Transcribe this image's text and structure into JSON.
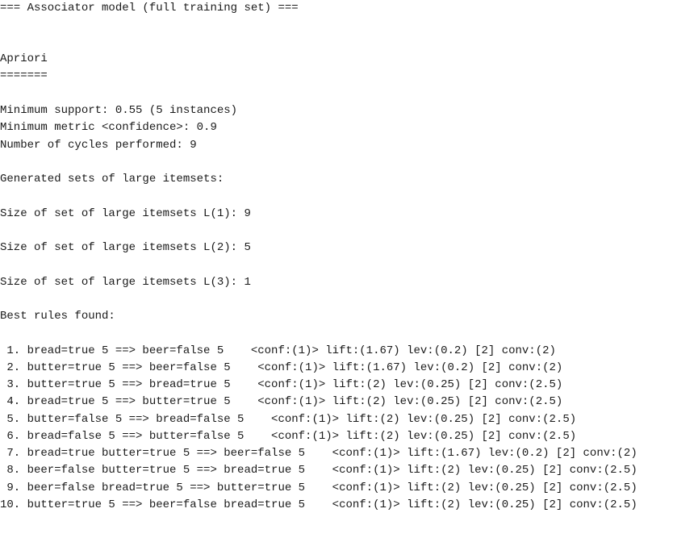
{
  "output": {
    "header": "=== Associator model (full training set) ===",
    "algorithm": "Apriori",
    "underline": "=======",
    "min_support": "Minimum support: 0.55 (5 instances)",
    "min_metric": "Minimum metric <confidence>: 0.9",
    "cycles": "Number of cycles performed: 9",
    "generated": "Generated sets of large itemsets:",
    "l1": "Size of set of large itemsets L(1): 9",
    "l2": "Size of set of large itemsets L(2): 5",
    "l3": "Size of set of large itemsets L(3): 1",
    "best_rules": "Best rules found:",
    "rules": [
      " 1. bread=true 5 ==> beer=false 5    <conf:(1)> lift:(1.67) lev:(0.2) [2] conv:(2)",
      " 2. butter=true 5 ==> beer=false 5    <conf:(1)> lift:(1.67) lev:(0.2) [2] conv:(2)",
      " 3. butter=true 5 ==> bread=true 5    <conf:(1)> lift:(2) lev:(0.25) [2] conv:(2.5)",
      " 4. bread=true 5 ==> butter=true 5    <conf:(1)> lift:(2) lev:(0.25) [2] conv:(2.5)",
      " 5. butter=false 5 ==> bread=false 5    <conf:(1)> lift:(2) lev:(0.25) [2] conv:(2.5)",
      " 6. bread=false 5 ==> butter=false 5    <conf:(1)> lift:(2) lev:(0.25) [2] conv:(2.5)",
      " 7. bread=true butter=true 5 ==> beer=false 5    <conf:(1)> lift:(1.67) lev:(0.2) [2] conv:(2)",
      " 8. beer=false butter=true 5 ==> bread=true 5    <conf:(1)> lift:(2) lev:(0.25) [2] conv:(2.5)",
      " 9. beer=false bread=true 5 ==> butter=true 5    <conf:(1)> lift:(2) lev:(0.25) [2] conv:(2.5)",
      "10. butter=true 5 ==> beer=false bread=true 5    <conf:(1)> lift:(2) lev:(0.25) [2] conv:(2.5)"
    ]
  }
}
